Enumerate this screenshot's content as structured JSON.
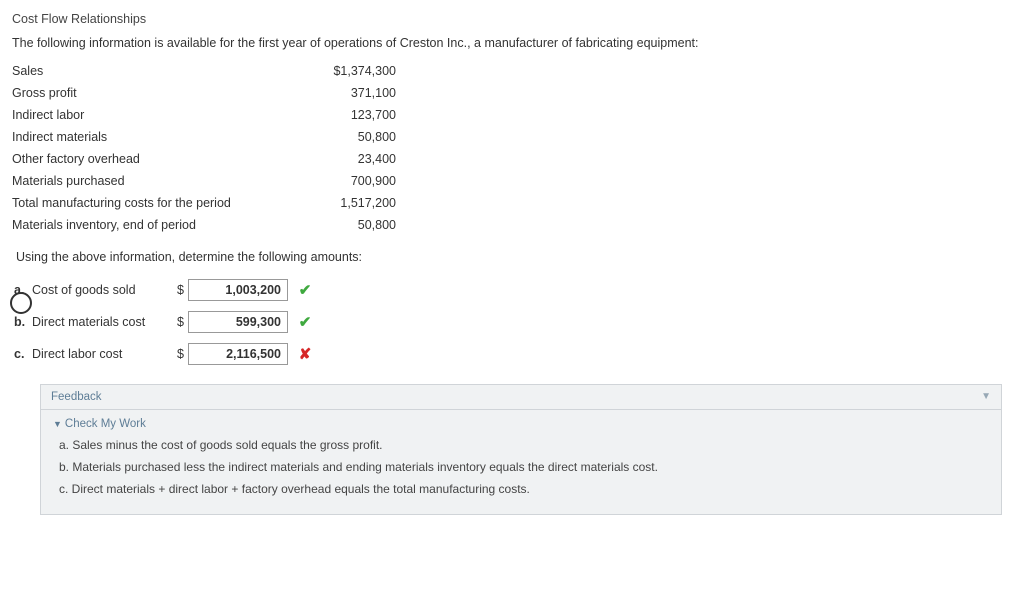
{
  "title": "Cost Flow Relationships",
  "intro": "The following information is available for the first year of operations of Creston Inc., a manufacturer of fabricating equipment:",
  "data_rows": [
    {
      "label": "Sales",
      "value": "$1,374,300"
    },
    {
      "label": "Gross profit",
      "value": "371,100"
    },
    {
      "label": "Indirect labor",
      "value": "123,700"
    },
    {
      "label": "Indirect materials",
      "value": "50,800"
    },
    {
      "label": "Other factory overhead",
      "value": "23,400"
    },
    {
      "label": "Materials purchased",
      "value": "700,900"
    },
    {
      "label": "Total manufacturing costs for the period",
      "value": "1,517,200"
    },
    {
      "label": "Materials inventory, end of period",
      "value": "50,800"
    }
  ],
  "subprompt": "Using the above information, determine the following amounts:",
  "answers": [
    {
      "letter": "a.",
      "label": "Cost of goods sold",
      "value": "1,003,200",
      "mark": "correct"
    },
    {
      "letter": "b.",
      "label": "Direct materials cost",
      "value": "599,300",
      "mark": "correct"
    },
    {
      "letter": "c.",
      "label": "Direct labor cost",
      "value": "2,116,500",
      "mark": "wrong"
    }
  ],
  "dollar": "$",
  "marks": {
    "correct": "✔",
    "wrong": "✘"
  },
  "feedback": {
    "header": "Feedback",
    "toggle": "Check My Work",
    "lines": [
      "a. Sales minus the cost of goods sold equals the gross profit.",
      "b. Materials purchased less the indirect materials and ending materials inventory equals the direct materials cost.",
      "c. Direct materials + direct labor + factory overhead equals the total manufacturing costs."
    ]
  }
}
